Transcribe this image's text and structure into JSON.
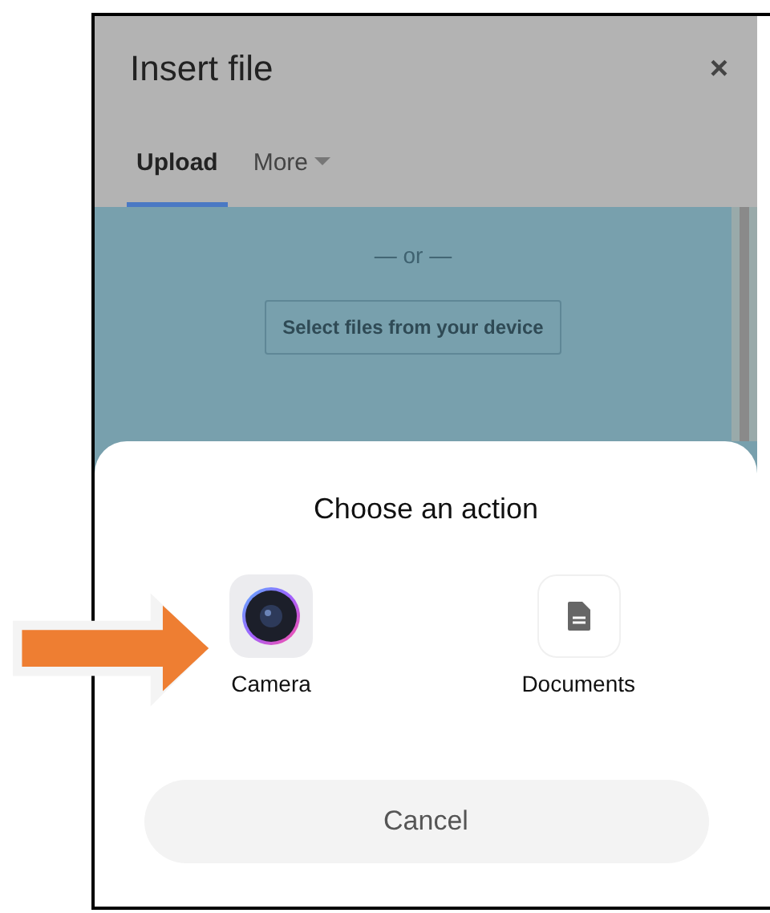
{
  "dialog": {
    "title": "Insert file",
    "close": "×"
  },
  "tabs": [
    {
      "label": "Upload",
      "selected": true,
      "dropdown": false
    },
    {
      "label": "More",
      "selected": false,
      "dropdown": true
    }
  ],
  "upload_area": {
    "divider": "— or —",
    "button": "Select files from your device"
  },
  "action_sheet": {
    "title": "Choose an action",
    "actions": [
      {
        "kind": "camera",
        "label": "Camera"
      },
      {
        "kind": "documents",
        "label": "Documents"
      }
    ],
    "cancel": "Cancel"
  }
}
